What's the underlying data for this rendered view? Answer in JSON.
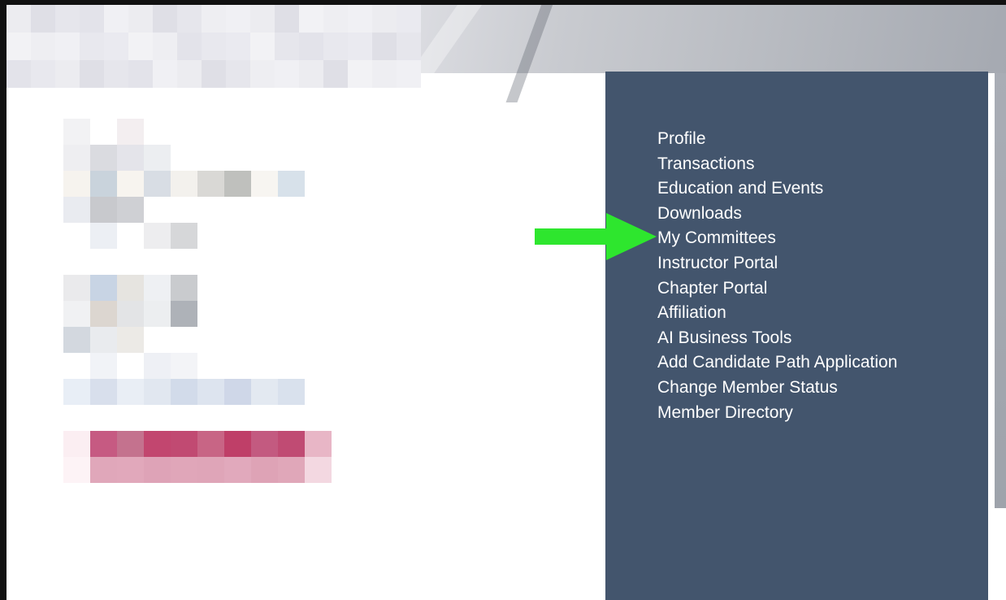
{
  "menu": {
    "items": [
      {
        "label": "Profile"
      },
      {
        "label": "Transactions"
      },
      {
        "label": "Education and Events"
      },
      {
        "label": "Downloads"
      },
      {
        "label": "My Committees"
      },
      {
        "label": "Instructor Portal"
      },
      {
        "label": "Chapter Portal"
      },
      {
        "label": "Affiliation"
      },
      {
        "label": "AI Business Tools"
      },
      {
        "label": "Add Candidate Path Application"
      },
      {
        "label": "Change Member Status"
      },
      {
        "label": "Member Directory"
      }
    ],
    "highlighted_item": "My Committees"
  },
  "annotation": {
    "icon": "arrow-right-icon",
    "color": "#2ee62e"
  },
  "colors": {
    "panel": "#43556d",
    "menu_text": "#ffffff",
    "pixelated_accent": "#c2466f"
  }
}
